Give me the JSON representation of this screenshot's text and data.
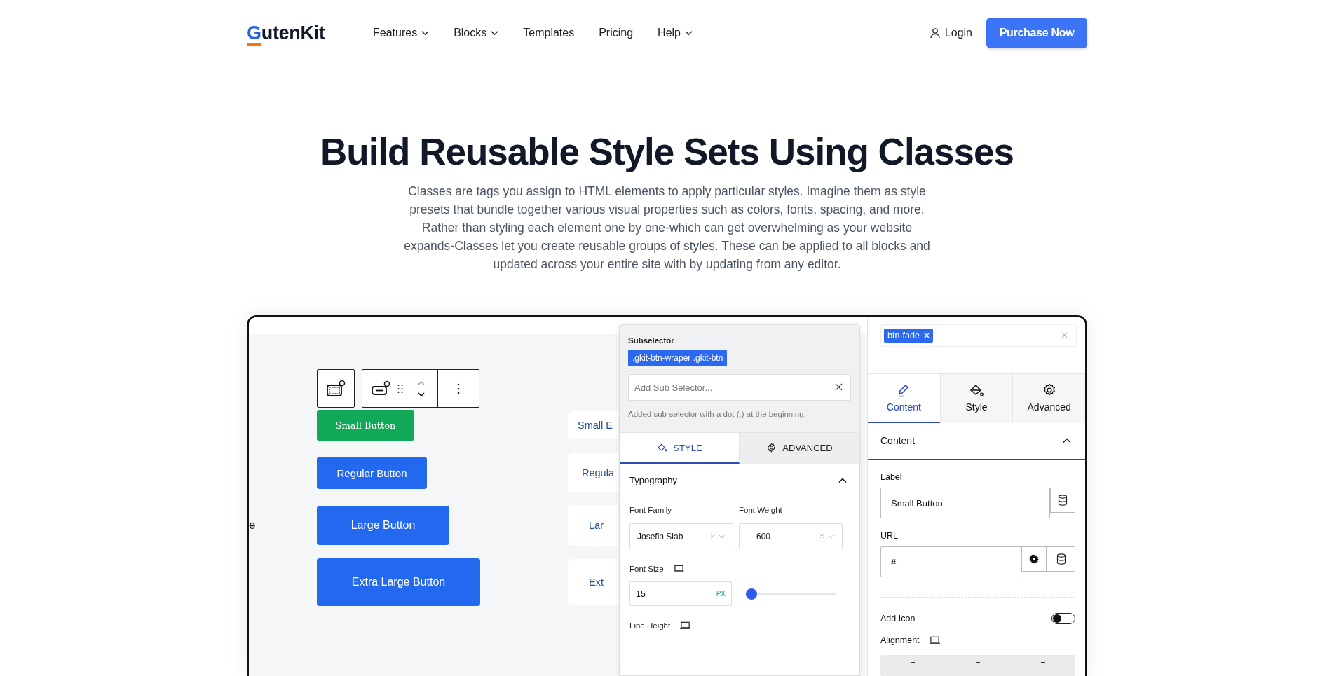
{
  "header": {
    "logo_mark": "G",
    "logo_text": "utenKit",
    "nav": [
      {
        "label": "Features",
        "dropdown": true
      },
      {
        "label": "Blocks",
        "dropdown": true
      },
      {
        "label": "Templates",
        "dropdown": false
      },
      {
        "label": "Pricing",
        "dropdown": false
      },
      {
        "label": "Help",
        "dropdown": true
      }
    ],
    "login": "Login",
    "cta": "Purchase Now"
  },
  "hero": {
    "title": "Build Reusable Style Sets Using Classes",
    "description": "Classes are tags you assign to HTML elements to apply particular styles. Imagine them as style presets that bundle together various visual properties such as colors, fonts, spacing, and more. Rather than styling each element one by one-which can get overwhelming as your website expands-Classes let you create reusable groups of styles. These can be applied to all blocks and updated across your entire site with by updating from any editor."
  },
  "editor": {
    "cut_text": "e",
    "buttons": [
      {
        "label": "Small Button",
        "color": "#0fa958"
      },
      {
        "label": "Regular Button",
        "color": "#2269f0"
      },
      {
        "label": "Large Button",
        "color": "#2269f0"
      },
      {
        "label": "Extra Large Button",
        "color": "#2269f0"
      }
    ],
    "preview_buttons": [
      "Small E",
      "Regula",
      "Lar",
      "Ext"
    ],
    "subselector_panel": {
      "heading": "Subselector",
      "selector": ".gkit-btn-wraper .gkit-btn",
      "placeholder": "Add Sub Selector...",
      "help": "Added sub-selector with a dot (.) at the beginning.",
      "tabs": [
        {
          "label": "STYLE",
          "selected": true
        },
        {
          "label": "ADVANCED",
          "selected": false
        }
      ],
      "section": {
        "title": "Typography",
        "expanded": true
      },
      "font_family": {
        "label": "Font Family",
        "value": "Josefin Slab"
      },
      "font_weight": {
        "label": "Font Weight",
        "value": "600"
      },
      "font_size": {
        "label": "Font Size",
        "value": "15",
        "unit": "PX",
        "level": 0.03
      },
      "line_height": {
        "label": "Line Height"
      }
    },
    "settings_panel": {
      "classes": [
        "btn-fade"
      ],
      "tabs": [
        {
          "label": "Content",
          "selected": true
        },
        {
          "label": "Style",
          "selected": false
        },
        {
          "label": "Advanced",
          "selected": false
        }
      ],
      "section": {
        "title": "Content",
        "expanded": true
      },
      "label_field": {
        "label": "Label",
        "value": "Small Button"
      },
      "url_field": {
        "label": "URL",
        "value": "#"
      },
      "add_icon": {
        "label": "Add Icon",
        "on": false
      },
      "alignment": {
        "label": "Alignment"
      }
    }
  }
}
